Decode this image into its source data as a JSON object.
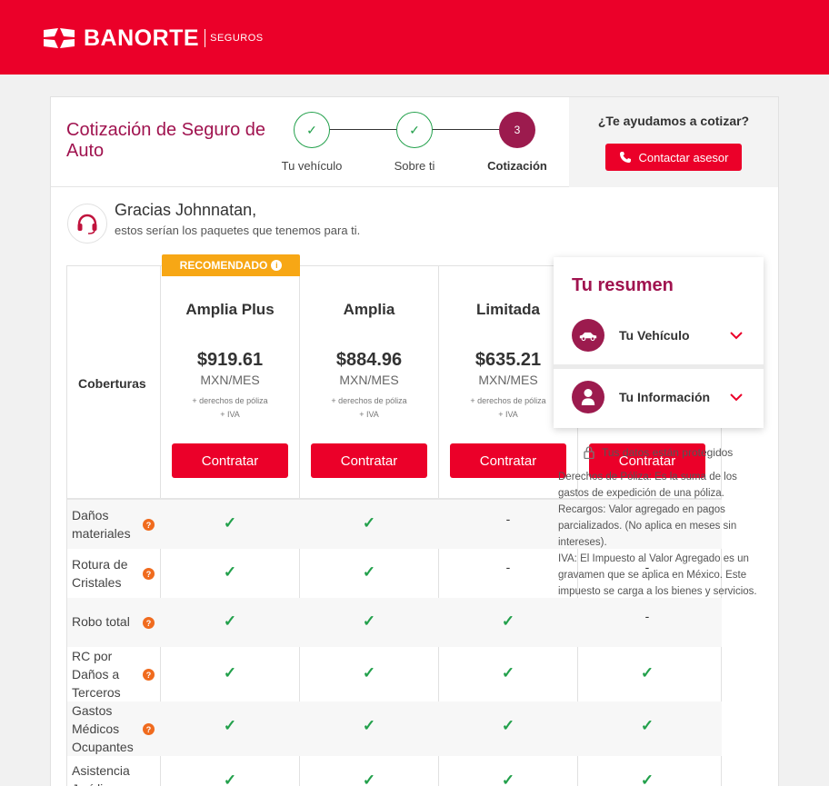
{
  "brand": {
    "name": "BANORTE",
    "sub": "SEGUROS"
  },
  "header": {
    "title": "Cotización de Seguro de Auto",
    "steps": [
      {
        "label": "Tu vehículo",
        "state": "done",
        "mark": "✓"
      },
      {
        "label": "Sobre ti",
        "state": "done",
        "mark": "✓"
      },
      {
        "label": "Cotización",
        "state": "active",
        "mark": "3"
      }
    ],
    "help_question": "¿Te ayudamos a cotizar?",
    "contact_button": "Contactar asesor"
  },
  "greeting": {
    "name_line": "Gracias Johnnatan,",
    "sub_line": "estos serían los paquetes que tenemos para ti."
  },
  "table": {
    "coverage_header": "Coberturas",
    "recommended_badge": "RECOMENDADO",
    "fee_line1": "+ derechos de póliza",
    "fee_line2": "+ IVA",
    "plans": [
      {
        "name": "Amplia Plus",
        "price": "$919.61",
        "period": "MXN/MES",
        "button": "Contratar"
      },
      {
        "name": "Amplia",
        "price": "$884.96",
        "period": "MXN/MES",
        "button": "Contratar"
      },
      {
        "name": "Limitada",
        "price": "$635.21",
        "period": "MXN/MES",
        "button": "Contratar"
      },
      {
        "name": "",
        "price": "",
        "period": "",
        "button": "Contratar"
      }
    ],
    "rows": [
      {
        "label": "Daños materiales",
        "values": [
          "✓",
          "✓",
          "-",
          ""
        ]
      },
      {
        "label": "Rotura de Cristales",
        "values": [
          "✓",
          "✓",
          "-",
          "-"
        ]
      },
      {
        "label": "Robo total",
        "values": [
          "✓",
          "✓",
          "✓",
          "-"
        ]
      },
      {
        "label": "RC por Daños a Terceros",
        "values": [
          "✓",
          "✓",
          "✓",
          "✓"
        ]
      },
      {
        "label": "Gastos Médicos Ocupantes",
        "values": [
          "✓",
          "✓",
          "✓",
          "✓"
        ]
      },
      {
        "label": "Asistencia Jurídica",
        "values": [
          "✓",
          "✓",
          "✓",
          "✓"
        ]
      }
    ]
  },
  "summary": {
    "title": "Tu resumen",
    "items": [
      {
        "label": "Tu Vehículo",
        "icon": "car-icon"
      },
      {
        "label": "Tu Información",
        "icon": "person-icon"
      }
    ]
  },
  "protected_text": "Tus datos están protegidos",
  "notes": [
    "Derechos de Póliza: Es la suma de los gastos de expedición de una póliza.",
    "Recargos: Valor agregado en pagos parcializados. (No aplica en meses sin intereses).",
    "IVA: El Impuesto al Valor Agregado es un gravamen que se aplica en México. Este impuesto se carga a los bienes y servicios."
  ],
  "colors": {
    "brand_red": "#eb0029",
    "wine": "#9c1b4e",
    "green": "#22a04b",
    "orange": "#f7a715"
  }
}
